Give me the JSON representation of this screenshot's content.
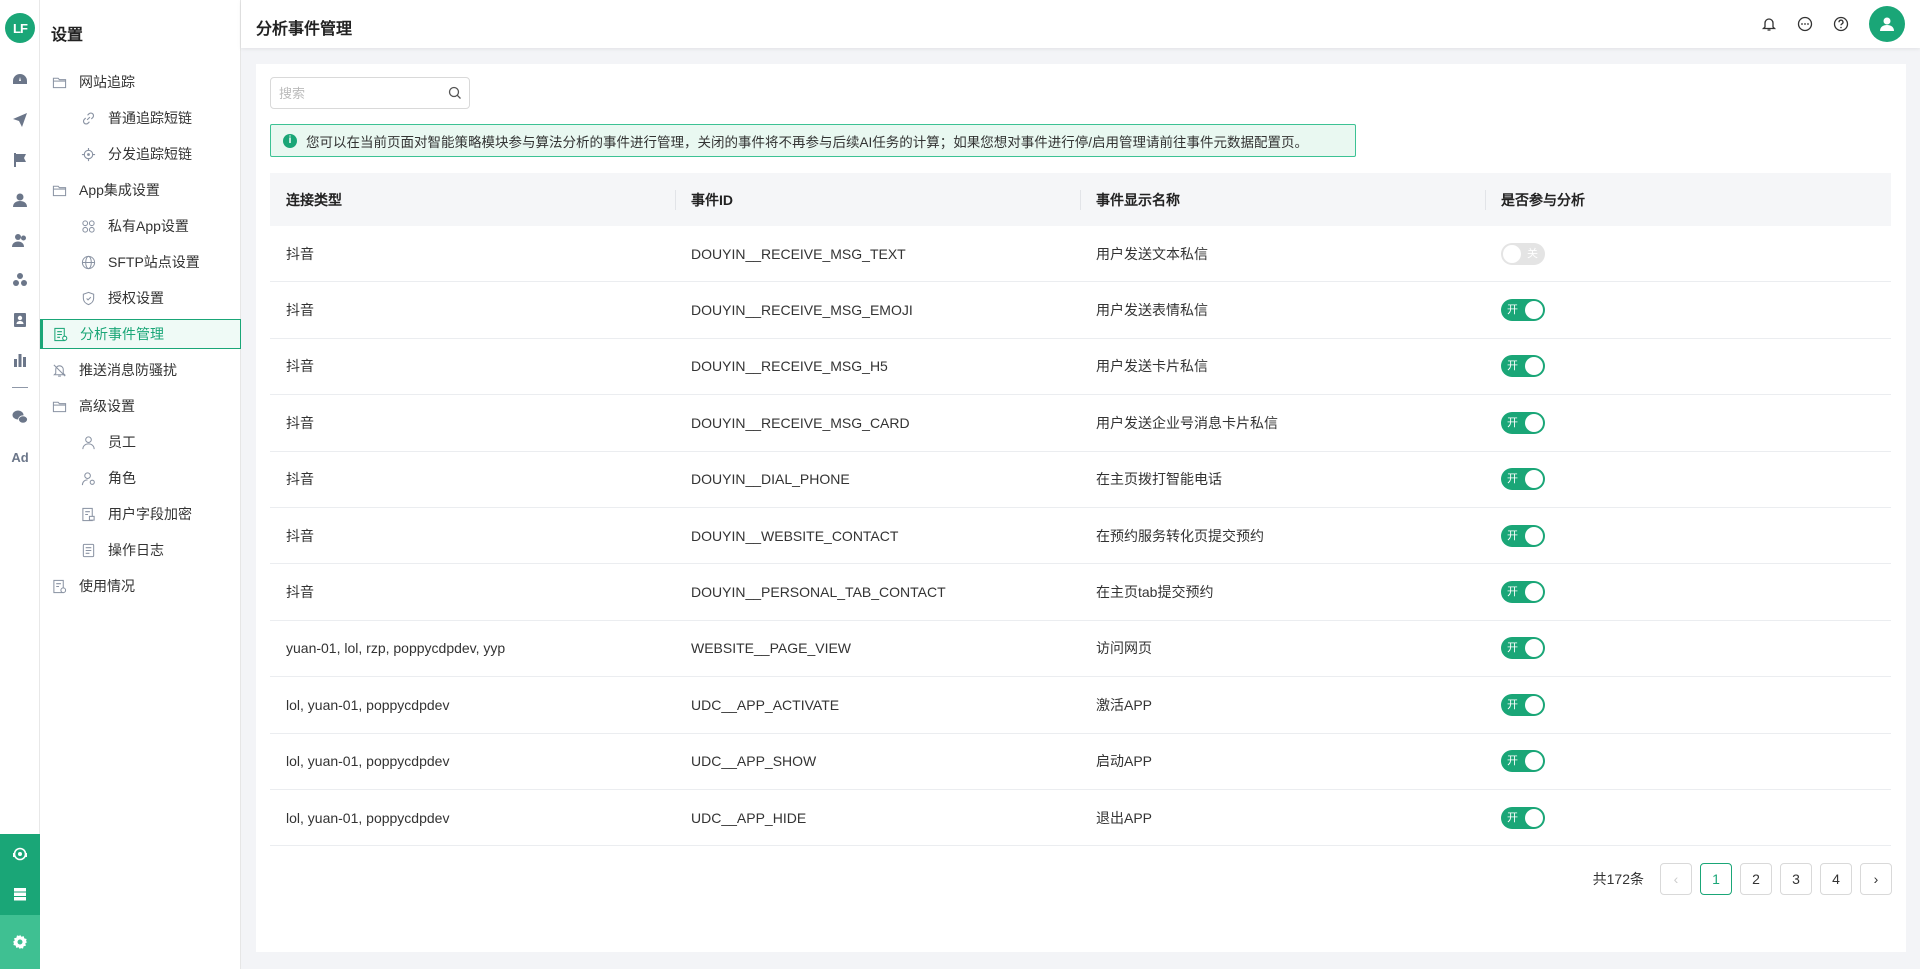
{
  "rail": {
    "logo": "LF",
    "ad_label": "Ad"
  },
  "sidebar": {
    "title": "设置",
    "items": [
      {
        "label": "网站追踪"
      },
      {
        "label": "普通追踪短链"
      },
      {
        "label": "分发追踪短链"
      },
      {
        "label": "App集成设置"
      },
      {
        "label": "私有App设置"
      },
      {
        "label": "SFTP站点设置"
      },
      {
        "label": "授权设置"
      },
      {
        "label": "分析事件管理"
      },
      {
        "label": "推送消息防骚扰"
      },
      {
        "label": "高级设置"
      },
      {
        "label": "员工"
      },
      {
        "label": "角色"
      },
      {
        "label": "用户字段加密"
      },
      {
        "label": "操作日志"
      },
      {
        "label": "使用情况"
      }
    ]
  },
  "header": {
    "title": "分析事件管理"
  },
  "search": {
    "placeholder": "搜索"
  },
  "alert": {
    "text": "您可以在当前页面对智能策略模块参与算法分析的事件进行管理，关闭的事件将不再参与后续AI任务的计算；如果您想对事件进行停/启用管理请前往事件元数据配置页。"
  },
  "table": {
    "columns": [
      "连接类型",
      "事件ID",
      "事件显示名称",
      "是否参与分析"
    ],
    "rows": [
      {
        "type": "抖音",
        "id": "DOUYIN__RECEIVE_MSG_TEXT",
        "name": "用户发送文本私信",
        "switch": "关",
        "on": false
      },
      {
        "type": "抖音",
        "id": "DOUYIN__RECEIVE_MSG_EMOJI",
        "name": "用户发送表情私信",
        "switch": "开",
        "on": true
      },
      {
        "type": "抖音",
        "id": "DOUYIN__RECEIVE_MSG_H5",
        "name": "用户发送卡片私信",
        "switch": "开",
        "on": true
      },
      {
        "type": "抖音",
        "id": "DOUYIN__RECEIVE_MSG_CARD",
        "name": "用户发送企业号消息卡片私信",
        "switch": "开",
        "on": true
      },
      {
        "type": "抖音",
        "id": "DOUYIN__DIAL_PHONE",
        "name": "在主页拨打智能电话",
        "switch": "开",
        "on": true
      },
      {
        "type": "抖音",
        "id": "DOUYIN__WEBSITE_CONTACT",
        "name": "在预约服务转化页提交预约",
        "switch": "开",
        "on": true
      },
      {
        "type": "抖音",
        "id": "DOUYIN__PERSONAL_TAB_CONTACT",
        "name": "在主页tab提交预约",
        "switch": "开",
        "on": true
      },
      {
        "type": "yuan-01, lol, rzp, poppycdpdev, yyp",
        "id": "WEBSITE__PAGE_VIEW",
        "name": "访问网页",
        "switch": "开",
        "on": true
      },
      {
        "type": "lol, yuan-01, poppycdpdev",
        "id": "UDC__APP_ACTIVATE",
        "name": "激活APP",
        "switch": "开",
        "on": true
      },
      {
        "type": "lol, yuan-01, poppycdpdev",
        "id": "UDC__APP_SHOW",
        "name": "启动APP",
        "switch": "开",
        "on": true
      },
      {
        "type": "lol, yuan-01, poppycdpdev",
        "id": "UDC__APP_HIDE",
        "name": "退出APP",
        "switch": "开",
        "on": true
      }
    ]
  },
  "pagination": {
    "total": "共172条",
    "prev": "‹",
    "next": "›",
    "pages": [
      "1",
      "2",
      "3",
      "4"
    ],
    "current": "1"
  },
  "colors": {
    "accent": "#1aa677"
  }
}
